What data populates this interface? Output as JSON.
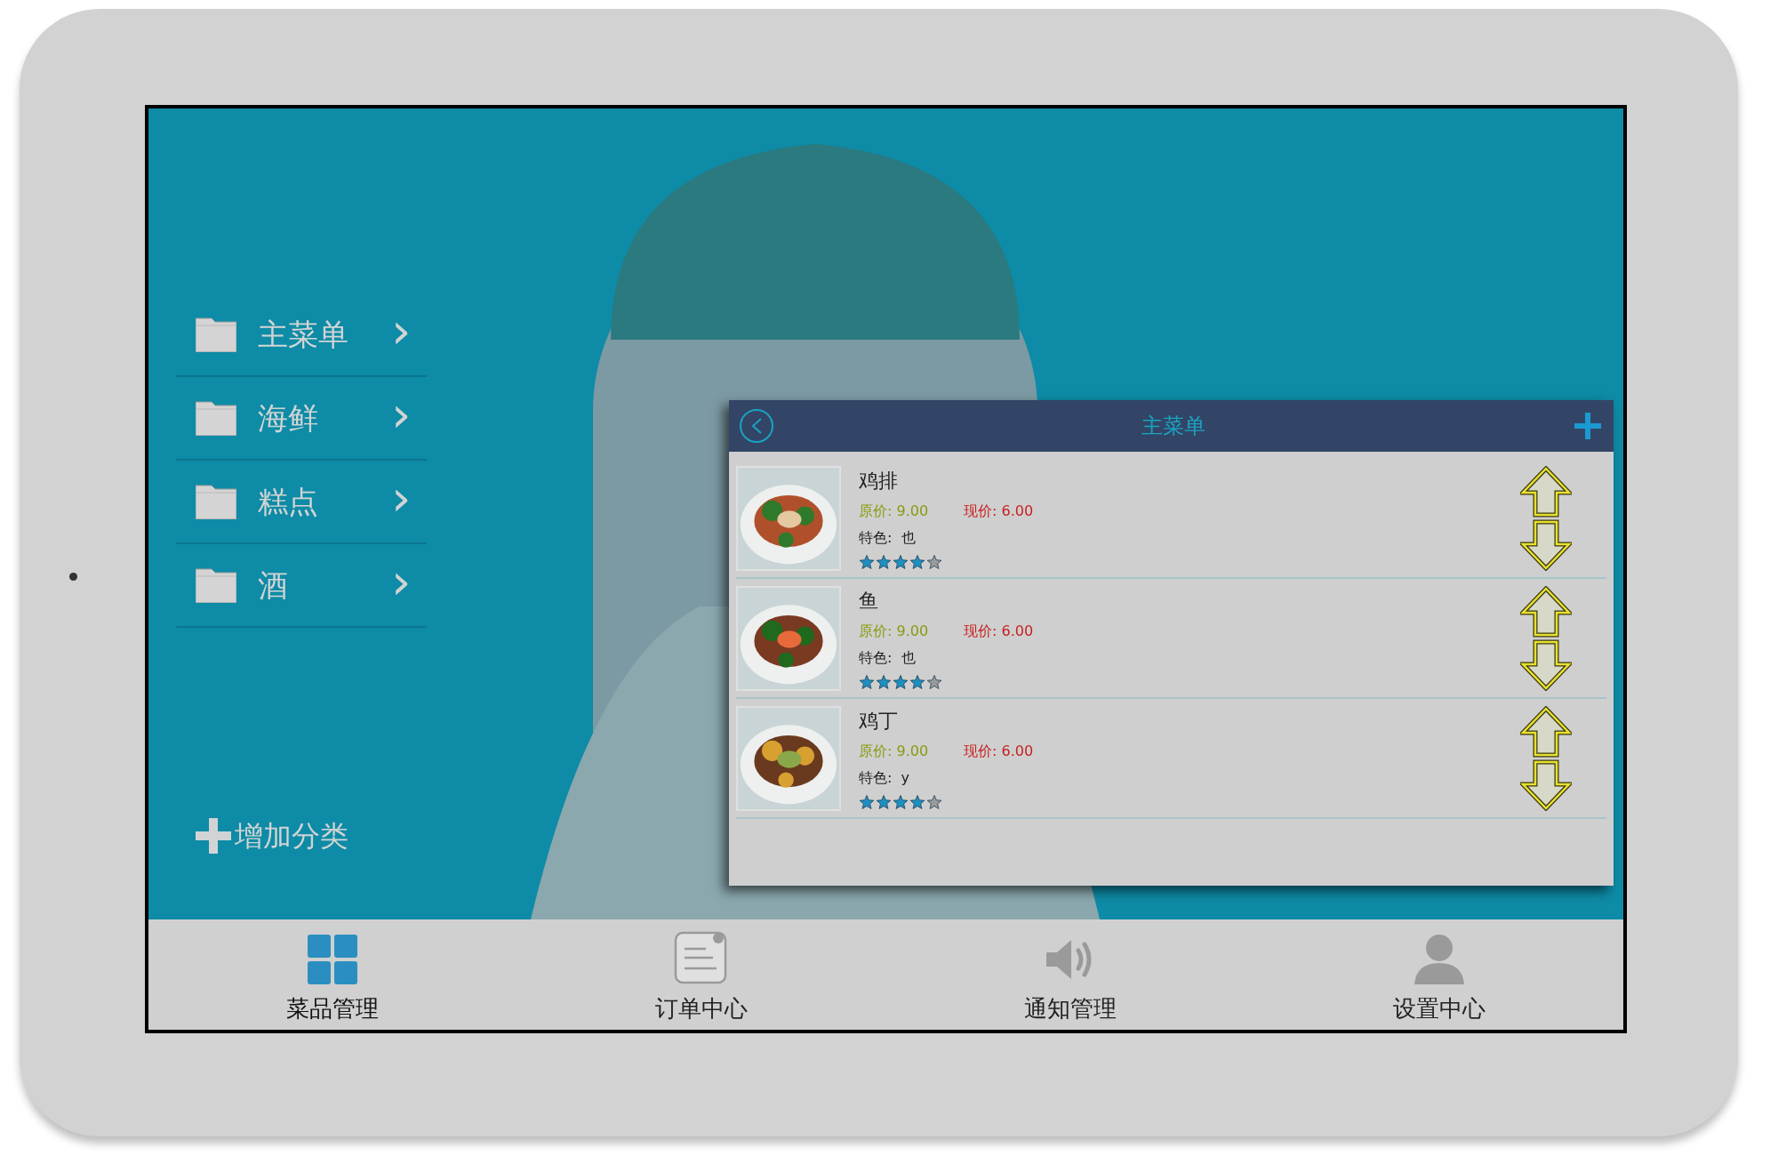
{
  "categories": [
    {
      "label": "主菜单",
      "chevron": "›"
    },
    {
      "label": "海鲜",
      "chevron": "›"
    },
    {
      "label": "糕点",
      "chevron": "›"
    },
    {
      "label": "酒",
      "chevron": "›"
    }
  ],
  "add_category": "增加分类",
  "dialog": {
    "title": "主菜单",
    "items": [
      {
        "name": "鸡排",
        "original_price": "原价: 9.00",
        "current_price": "现价: 6.00",
        "feature": "特色:  也",
        "stars": 4
      },
      {
        "name": "鱼",
        "original_price": "原价: 9.00",
        "current_price": "现价: 6.00",
        "feature": "特色:  也",
        "stars": 4
      },
      {
        "name": "鸡丁",
        "original_price": "原价: 9.00",
        "current_price": "现价: 6.00",
        "feature": "特色:  y",
        "stars": 4
      }
    ]
  },
  "tabs": [
    {
      "label": "菜品管理",
      "kind": "grid",
      "selected": true
    },
    {
      "label": "订单中心",
      "kind": "note",
      "selected": false
    },
    {
      "label": "通知管理",
      "kind": "speaker",
      "selected": false
    },
    {
      "label": "设置中心",
      "kind": "person",
      "selected": false
    }
  ]
}
